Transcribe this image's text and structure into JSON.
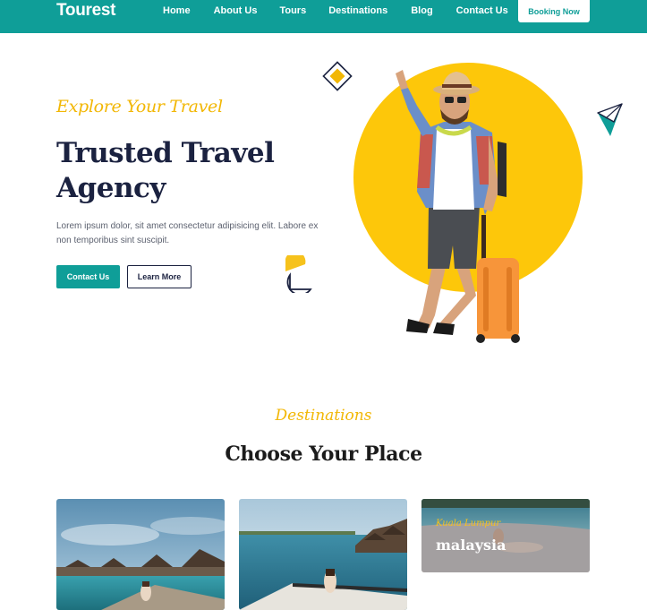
{
  "brand": {
    "name": "Tourest"
  },
  "nav": {
    "items": [
      {
        "label": "Home"
      },
      {
        "label": "About Us"
      },
      {
        "label": "Tours"
      },
      {
        "label": "Destinations"
      },
      {
        "label": "Blog"
      },
      {
        "label": "Contact Us"
      }
    ],
    "cta": "Booking Now"
  },
  "hero": {
    "kicker": "Explore Your Travel",
    "title_line1": "Trusted Travel",
    "title_line2": "Agency",
    "description": "Lorem ipsum dolor, sit amet consectetur adipisicing elit. Labore ex non temporibus sint suscipit.",
    "primary_button": "Contact Us",
    "secondary_button": "Learn More"
  },
  "destinations": {
    "kicker": "Destinations",
    "title": "Choose Your Place",
    "cards": [
      {
        "kicker": "",
        "name": ""
      },
      {
        "kicker": "",
        "name": ""
      },
      {
        "kicker": "Kuala Lumpur",
        "name": "malaysia"
      }
    ]
  },
  "colors": {
    "brand_teal": "#0f9e98",
    "accent_yellow": "#f2b705",
    "navy": "#1b2240"
  }
}
